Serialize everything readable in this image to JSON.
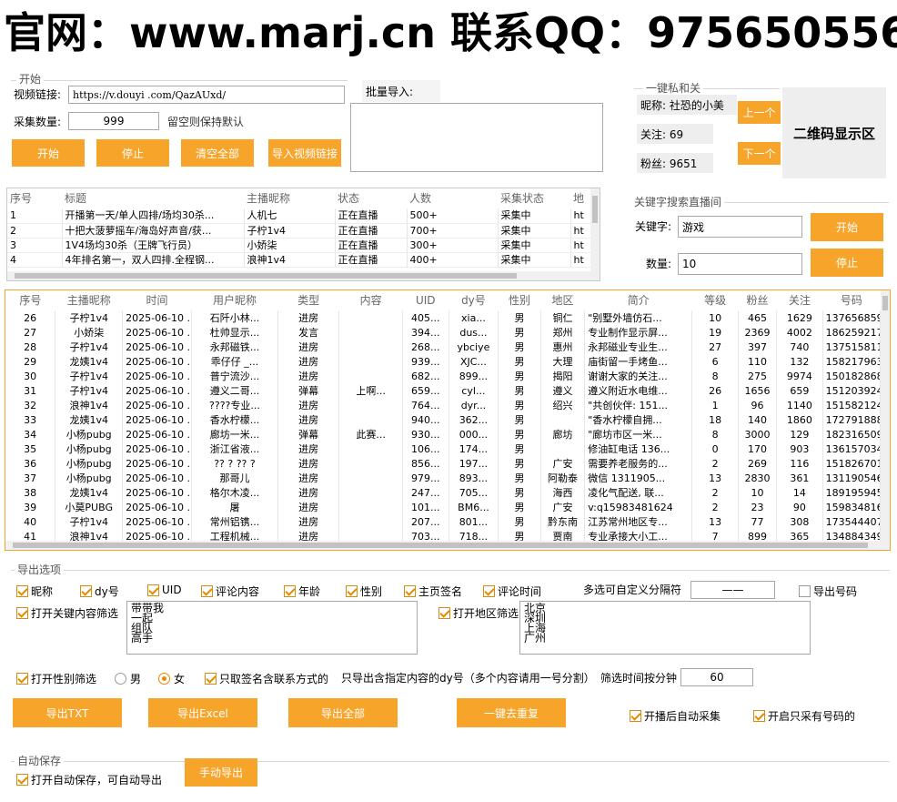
{
  "banner": "官网：www.marj.cn 联系QQ：975650556",
  "start": {
    "title": "开始",
    "video_link_label": "视频链接:",
    "video_link_value": "https://v.douyi .com/QazAUxd/",
    "count_label": "采集数量:",
    "count_value": "999",
    "count_hint": "留空则保持默认",
    "buttons": [
      "开始",
      "停止",
      "清空全部",
      "导入视频链接"
    ],
    "batch_label": "批量导入:"
  },
  "private": {
    "title": "一键私和关",
    "nickname": "昵称: 社恐的小美",
    "follow": "关注: 69",
    "fans": "粉丝: 9651",
    "prev": "上一个",
    "next": "下一个",
    "qr": "二维码显示区"
  },
  "keyword": {
    "title": "关键字搜索直播间",
    "kw_label": "关键字:",
    "kw_value": "游戏",
    "num_label": "数量:",
    "num_value": "10",
    "start": "开始",
    "stop": "停止"
  },
  "rooms": {
    "headers": [
      "序号",
      "标题",
      "主播昵称",
      "状态",
      "人数",
      "采集状态",
      "地"
    ],
    "rows": [
      [
        "1",
        "开播第一天/单人四排/场均30杀...",
        "人机七",
        "正在直播",
        "500+",
        "采集中",
        "ht"
      ],
      [
        "2",
        "十把大菠萝摇车/海岛好声音/获...",
        "子柠1v4",
        "正在直播",
        "700+",
        "采集中",
        "ht"
      ],
      [
        "3",
        "1V4场均30杀（王牌飞行员）",
        "小娇柒",
        "正在直播",
        "300+",
        "采集中",
        "ht"
      ],
      [
        "4",
        "4年排名第一，双人四排.全程钢...",
        "浪神1v4",
        "正在直播",
        "400+",
        "采集中",
        "ht"
      ]
    ]
  },
  "comments": {
    "headers": [
      "序号",
      "主播昵称",
      "时间",
      "用户昵称",
      "类型",
      "内容",
      "UID",
      "dy号",
      "性别",
      "地区",
      "简介",
      "等级",
      "粉丝",
      "关注",
      "号码"
    ],
    "rows": [
      [
        "26",
        "子柠1v4",
        "2025-06-10 ...",
        "石阡小林...",
        "进房",
        "",
        "405...",
        "xia...",
        "男",
        "铜仁",
        "\"别墅外墙仿石...",
        "10",
        "465",
        "1629",
        "137656859"
      ],
      [
        "27",
        "小娇柒",
        "2025-06-10 ...",
        "杜帅显示...",
        "发言",
        "",
        "394...",
        "dus...",
        "男",
        "郑州",
        "专业制作显示屏...",
        "19",
        "2369",
        "4002",
        "186259217"
      ],
      [
        "28",
        "子柠1v4",
        "2025-06-10 ...",
        "永邦磁铁...",
        "进房",
        "",
        "268...",
        "ybciye",
        "男",
        "惠州",
        "永邦磁业专业生...",
        "27",
        "397",
        "740",
        "137515811"
      ],
      [
        "29",
        "龙姨1v4",
        "2025-06-10 ...",
        "乖仔仔 _...",
        "进房",
        "",
        "939...",
        "XJC...",
        "男",
        "大理",
        "庙街留一手烤鱼...",
        "6",
        "110",
        "132",
        "158217963"
      ],
      [
        "30",
        "子柠1v4",
        "2025-06-10 ...",
        "普宁流沙...",
        "进房",
        "",
        "682...",
        "899...",
        "男",
        "揭阳",
        "谢谢大家的关注...",
        "8",
        "275",
        "9974",
        "150182868"
      ],
      [
        "31",
        "子柠1v4",
        "2025-06-10 ...",
        "遵义二哥...",
        "弹幕",
        "上啊...",
        "659...",
        "cyl...",
        "男",
        "遵义",
        "遵义附近水电维...",
        "26",
        "1656",
        "659",
        "151203924"
      ],
      [
        "32",
        "浪神1v4",
        "2025-06-10 ...",
        "????专业...",
        "进房",
        "",
        "764...",
        "dyr...",
        "男",
        "绍兴",
        "\"共创伙伴: 151...",
        "1",
        "96",
        "1140",
        "151582124"
      ],
      [
        "33",
        "龙姨1v4",
        "2025-06-10 ...",
        "香水柠檬...",
        "进房",
        "",
        "940...",
        "362...",
        "男",
        "",
        "\"香水柠檬自拥...",
        "18",
        "140",
        "1860",
        "172791888"
      ],
      [
        "34",
        "小杨pubg",
        "2025-06-10 ...",
        "廊坊一米...",
        "弹幕",
        "此赛...",
        "930...",
        "000...",
        "男",
        "廊坊",
        "\"廊坊市区一米...",
        "8",
        "3000",
        "129",
        "182316509"
      ],
      [
        "35",
        "小杨pubg",
        "2025-06-10 ...",
        "浙江省液...",
        "进房",
        "",
        "106...",
        "174...",
        "男",
        "",
        "修油缸电话 136...",
        "0",
        "170",
        "903",
        "136157034"
      ],
      [
        "36",
        "小杨pubg",
        "2025-06-10 ...",
        "?? ? ?? ?",
        "进房",
        "",
        "856...",
        "197...",
        "男",
        "广安",
        "需要养老服务的...",
        "2",
        "269",
        "116",
        "151826701"
      ],
      [
        "37",
        "小杨pubg",
        "2025-06-10 ...",
        "那哥儿",
        "进房",
        "",
        "979...",
        "893...",
        "男",
        "阿勒泰",
        "微信 1311905...",
        "13",
        "2830",
        "361",
        "131190546"
      ],
      [
        "38",
        "龙姨1v4",
        "2025-06-10 ...",
        "格尔木凌...",
        "进房",
        "",
        "247...",
        "705...",
        "男",
        "海西",
        "凌化气配送, 联...",
        "2",
        "10",
        "14",
        "189195945"
      ],
      [
        "39",
        "小莫PUBG",
        "2025-06-10 ...",
        "屠",
        "进房",
        "",
        "101...",
        "BM6...",
        "男",
        "广安",
        "v:q15983481624",
        "2",
        "23",
        "90",
        "159834816"
      ],
      [
        "40",
        "子柠1v4",
        "2025-06-10 ...",
        "常州铝镌...",
        "进房",
        "",
        "207...",
        "801...",
        "男",
        "黔东南",
        "江苏常州地区专...",
        "13",
        "77",
        "308",
        "173544407"
      ],
      [
        "41",
        "浪神1v4",
        "2025-06-10 ...",
        "工程机械...",
        "进房",
        "",
        "703...",
        "718...",
        "男",
        "贾南",
        "专业承接大小工...",
        "7",
        "899",
        "365",
        "134884349"
      ]
    ]
  },
  "export": {
    "title": "导出选项",
    "fields": [
      "昵称",
      "dy号",
      "UID",
      "评论内容",
      "年龄",
      "性别",
      "主页签名",
      "评论时间"
    ],
    "sep_label": "多选可自定义分隔符",
    "sep_value": "——",
    "export_phone": "导出号码",
    "kw_filter_label": "打开关键内容筛选",
    "kw_filter_items": [
      "带带我",
      "一起",
      "组队",
      "高手"
    ],
    "region_filter_label": "打开地区筛选",
    "region_items": [
      "北京",
      "深圳",
      "上海",
      "广州"
    ],
    "gender_filter_label": "打开性别筛选",
    "male": "男",
    "female": "女",
    "sign_only": "只取签名含联系方式的",
    "dy_only": "只导出含指定内容的dy号（多个内容请用一号分割）",
    "time_filter_label": "筛选时间按分钟",
    "time_filter_value": "60",
    "buttons": [
      "导出TXT",
      "导出Excel",
      "导出全部",
      "一键去重复"
    ],
    "auto_collect": "开播后自动采集",
    "phone_only": "开启只采有号码的"
  },
  "autosave": {
    "title": "自动保存",
    "label": "打开自动保存，可自动导出",
    "button": "手动导出"
  },
  "colors": {
    "accent": "#f7a52a",
    "highlight_border": "#f7a52a"
  }
}
